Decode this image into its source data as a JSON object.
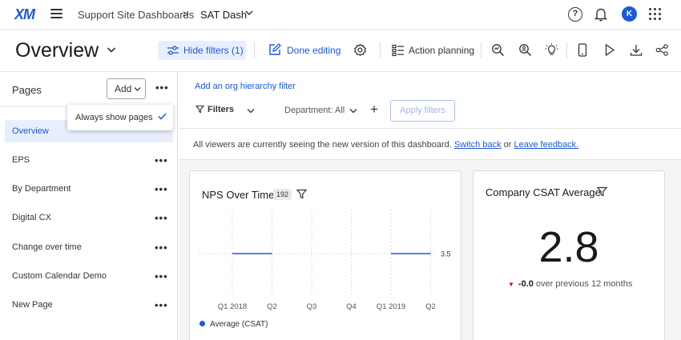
{
  "topbar": {
    "logo": "XM",
    "breadcrumb": [
      "Support Site Dashboards",
      "SAT Dash"
    ],
    "breadcrumb_sep": ">",
    "avatar_initial": "K"
  },
  "toolbar": {
    "page_title": "Overview",
    "hide_filters": "Hide filters (1)",
    "done_editing": "Done editing",
    "action_planning": "Action planning"
  },
  "sidebar": {
    "title": "Pages",
    "add_label": "Add",
    "popover_label": "Always show pages",
    "items": [
      {
        "label": "Overview",
        "active": true
      },
      {
        "label": "EPS"
      },
      {
        "label": "By Department"
      },
      {
        "label": "Digital CX"
      },
      {
        "label": "Change over time"
      },
      {
        "label": "Custom Calendar Demo"
      },
      {
        "label": "New Page"
      }
    ]
  },
  "filters": {
    "org_link": "Add an org hierarchy filter",
    "label": "Filters",
    "department": "Department: All",
    "apply": "Apply filters"
  },
  "notice": {
    "text": "All viewers are currently seeing the new version of this dashboard.",
    "switch_back": "Switch back",
    "or": "or",
    "feedback": "Leave feedback."
  },
  "nps_card": {
    "title": "NPS Over Time",
    "count": "192"
  },
  "csat_card": {
    "title": "Company CSAT Average",
    "value": "2.8",
    "change": "-0.0",
    "change_text": "over previous 12 months",
    "arrow_color": "#d0021b"
  },
  "colors": {
    "accent": "#1c59d8",
    "accent_bg": "#e8effc"
  },
  "chart_data": {
    "type": "line",
    "categories": [
      "Q1 2018",
      "Q2",
      "Q3",
      "Q4",
      "Q1 2019",
      "Q2"
    ],
    "series": [
      {
        "name": "Average (CSAT)",
        "values": [
          3.5,
          3.5,
          null,
          null,
          3.5,
          3.5
        ],
        "color": "#1c59d8"
      }
    ],
    "data_labels": [
      "3.5"
    ],
    "grid": true,
    "legend": "bottom-left"
  }
}
